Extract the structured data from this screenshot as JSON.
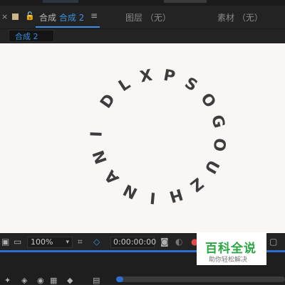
{
  "tabs": {
    "close": "×",
    "lock": "🔓",
    "composition_prefix": "合成",
    "composition_name": "合成 2",
    "menu": "≡",
    "layer": "图层  （无）",
    "material": "素材  （无）"
  },
  "breadcrumb": {
    "label": "合成 2"
  },
  "canvas": {
    "circle_text": [
      "D",
      "L",
      "X",
      "P",
      "S",
      "O",
      "G",
      "O",
      "U",
      "Z",
      "H",
      "I",
      "N",
      "A",
      "N",
      "I"
    ]
  },
  "toolbar": {
    "zoom": "100%",
    "zoom_caret": "▾",
    "timecode": "0:00:00:00"
  },
  "watermark": {
    "title": "百科全说",
    "subtitle": "助你轻松解决"
  },
  "colors": {
    "accent": "#3a8fe0",
    "blue_bar": "#2d6fd1",
    "canvas_bg": "#faf6f5",
    "text_dark": "#3d3d3d",
    "watermark_green": "#2aa642"
  }
}
